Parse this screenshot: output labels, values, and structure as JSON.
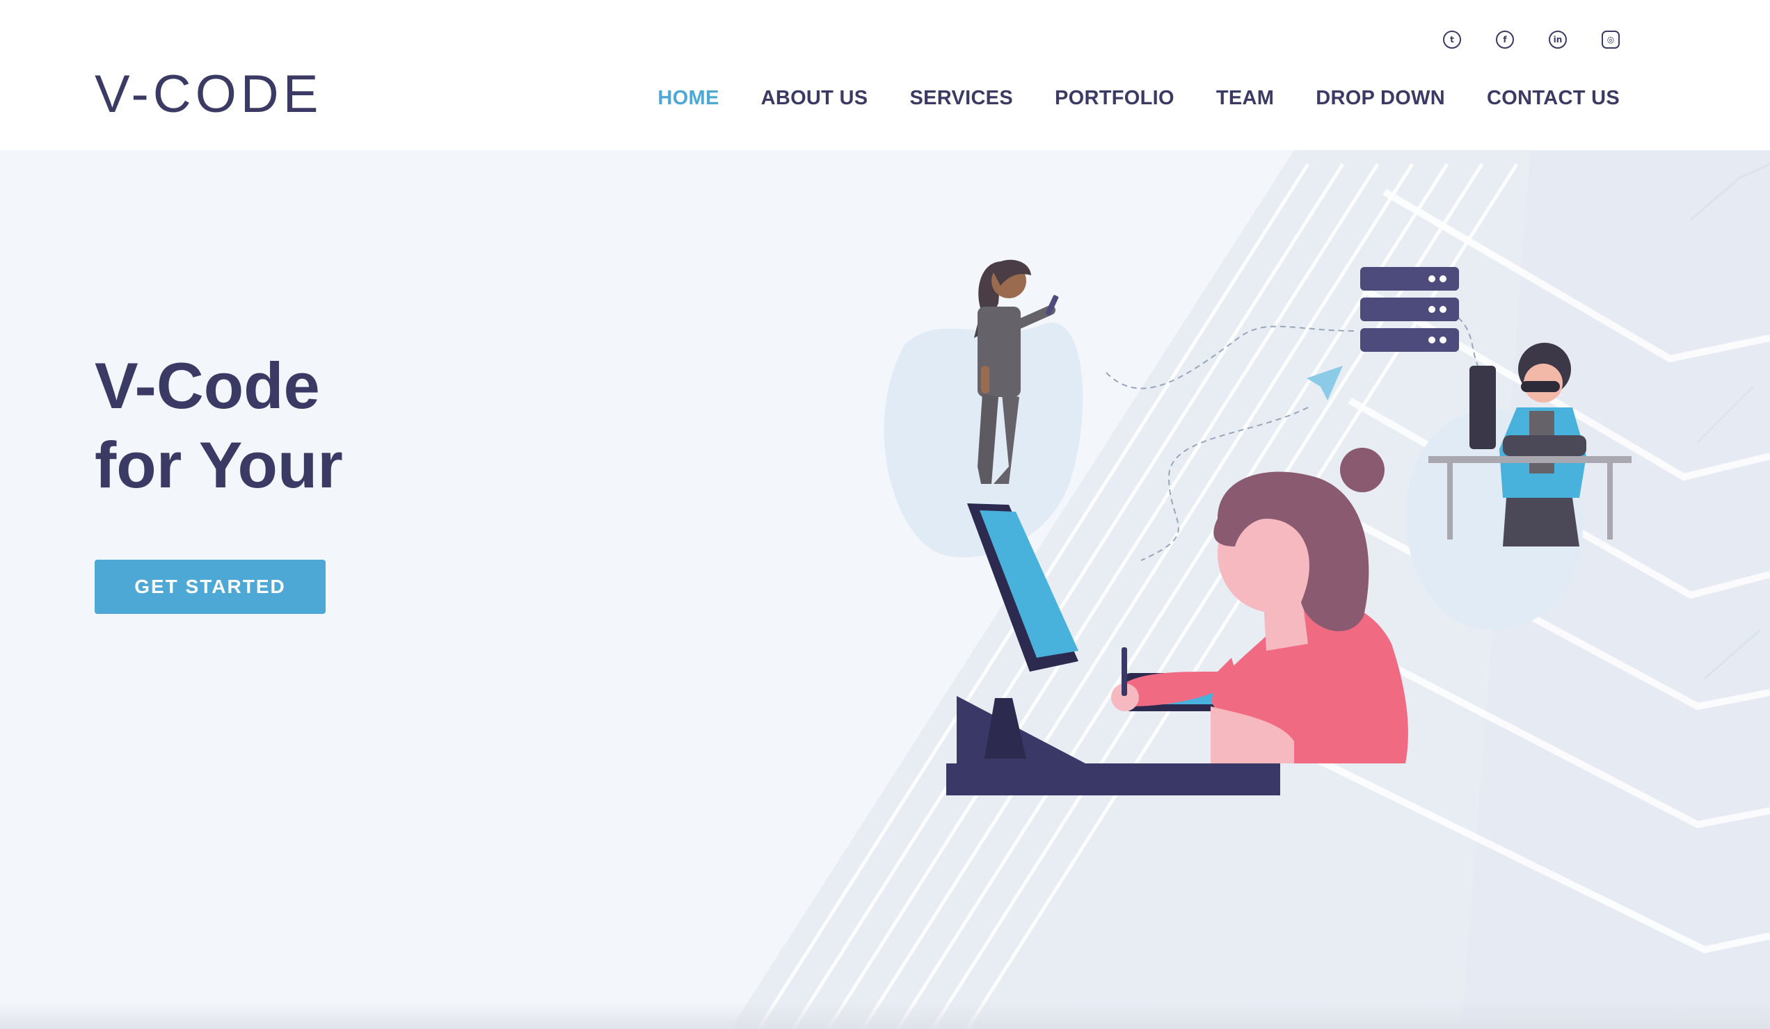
{
  "brand": {
    "logo_text": "V-CODE"
  },
  "social": [
    {
      "name": "twitter-icon",
      "glyph": "t"
    },
    {
      "name": "facebook-icon",
      "glyph": "f"
    },
    {
      "name": "linkedin-icon",
      "glyph": "in"
    },
    {
      "name": "instagram-icon",
      "glyph": "◎"
    }
  ],
  "nav": {
    "items": [
      {
        "label": "HOME",
        "active": true
      },
      {
        "label": "ABOUT US"
      },
      {
        "label": "SERVICES"
      },
      {
        "label": "PORTFOLIO"
      },
      {
        "label": "TEAM"
      },
      {
        "label": "DROP DOWN"
      },
      {
        "label": "CONTACT US"
      }
    ]
  },
  "hero": {
    "title_line1": "V-Code",
    "title_line2": "for Your",
    "cta_label": "GET STARTED"
  },
  "colors": {
    "primary": "#3a3a64",
    "accent": "#4ea8d6",
    "hero_bg": "#f3f6fb"
  }
}
